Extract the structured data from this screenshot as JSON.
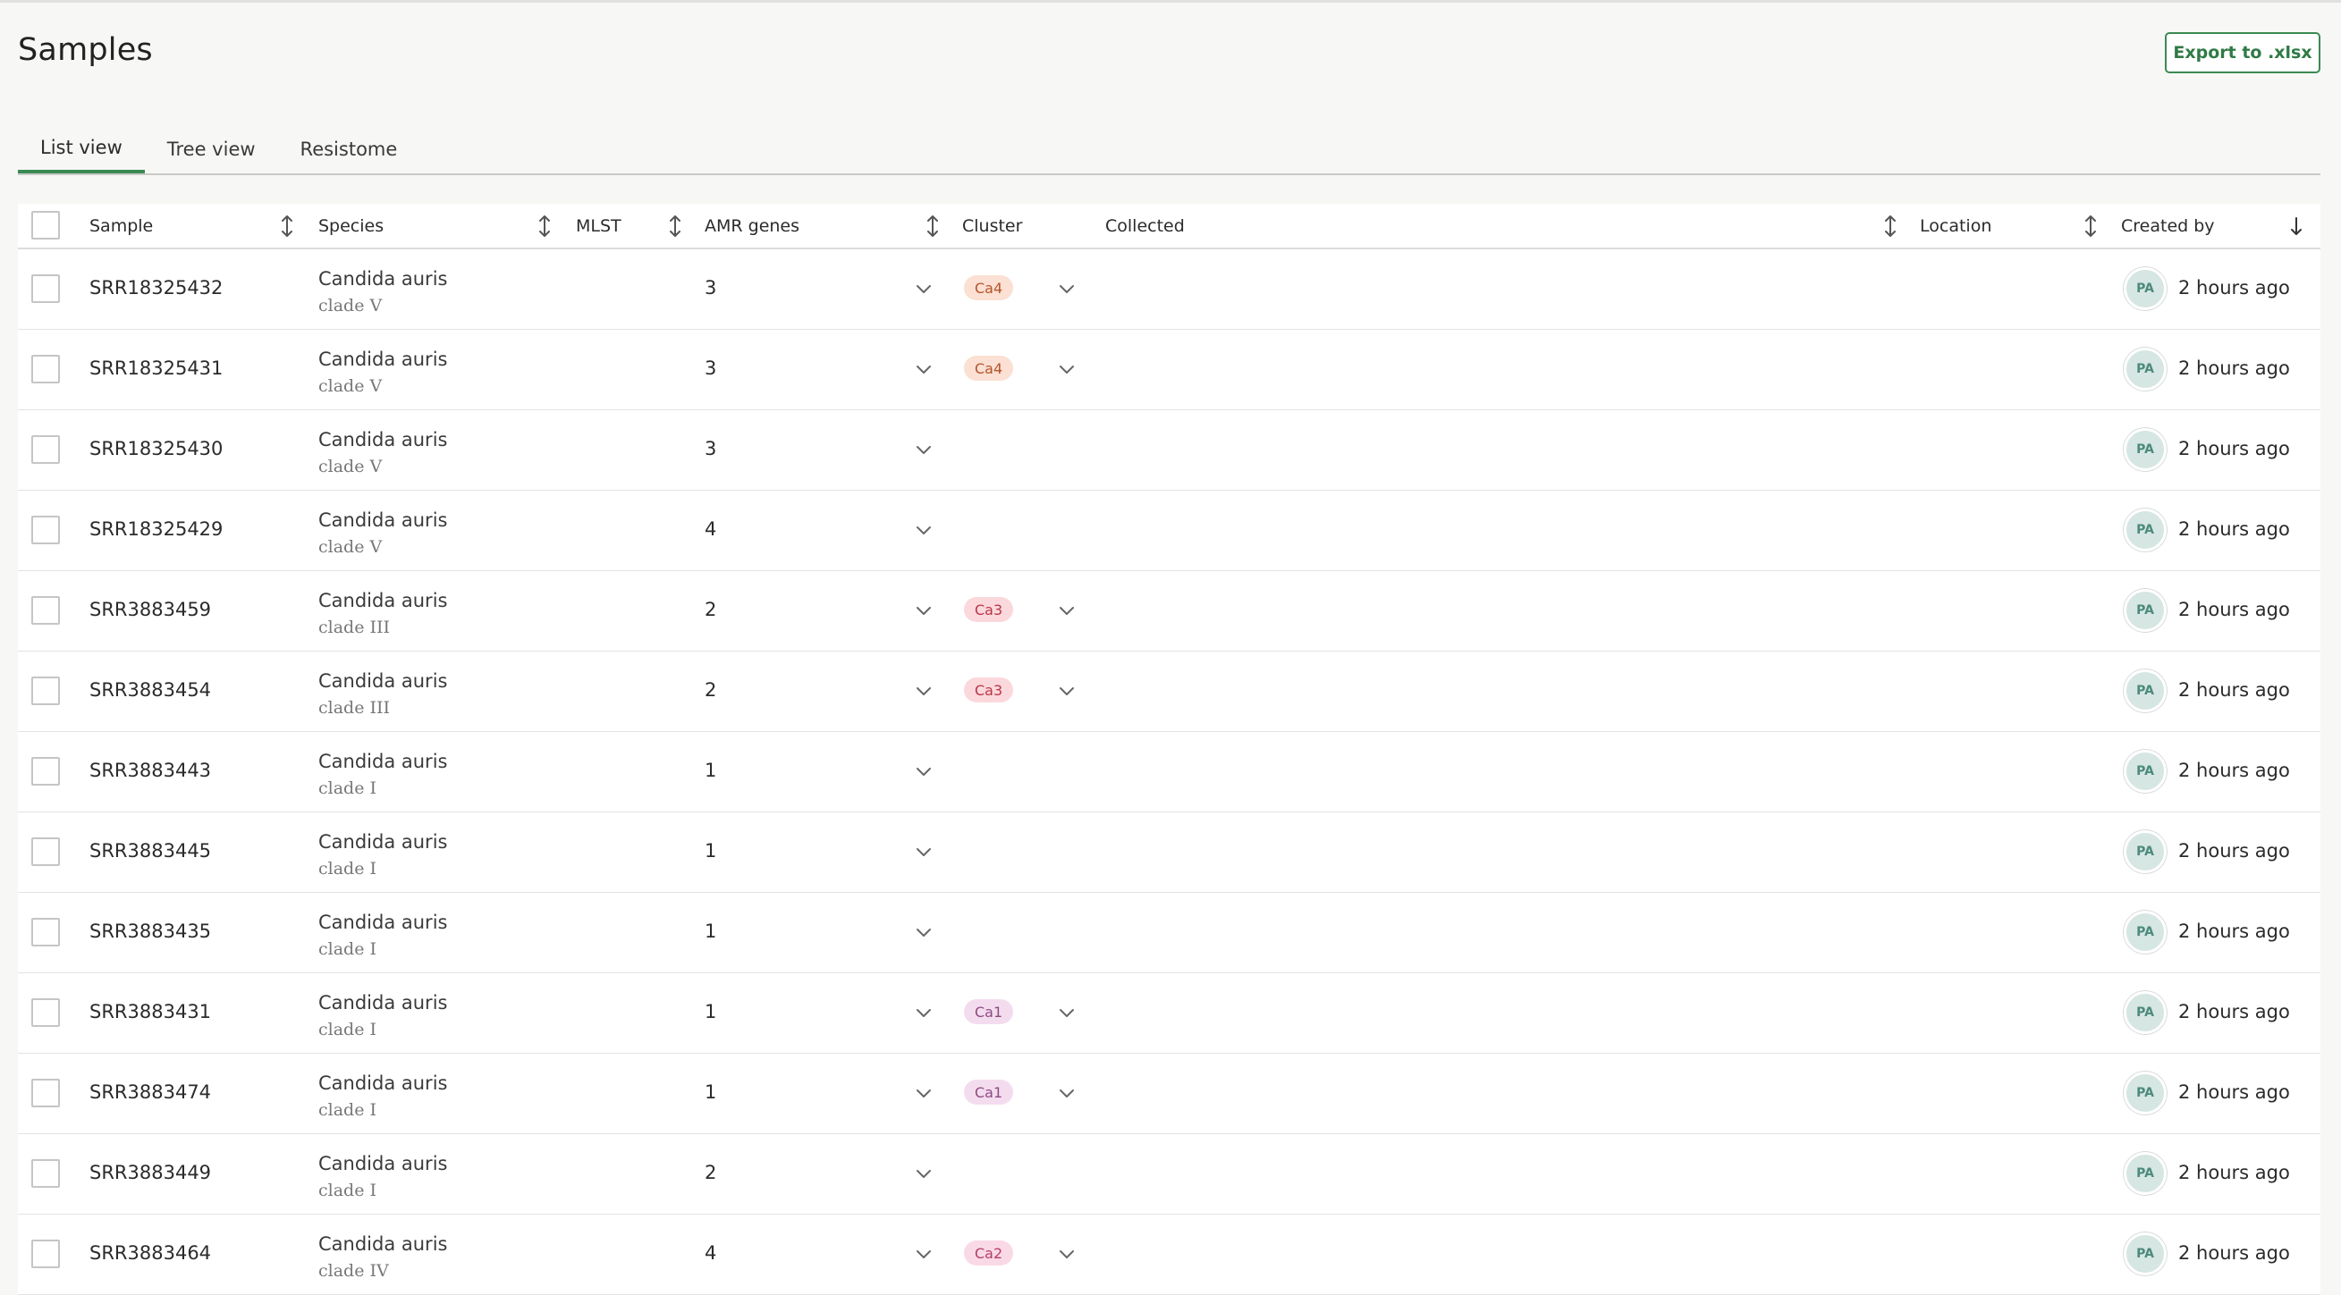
{
  "page": {
    "title": "Samples",
    "export_label": "Export to .xlsx"
  },
  "tabs": [
    {
      "label": "List view",
      "active": true
    },
    {
      "label": "Tree view",
      "active": false
    },
    {
      "label": "Resistome",
      "active": false
    }
  ],
  "columns": {
    "sample": "Sample",
    "species": "Species",
    "mlst": "MLST",
    "amr": "AMR genes",
    "cluster": "Cluster",
    "collected": "Collected",
    "location": "Location",
    "created_by": "Created by"
  },
  "colors": {
    "accent": "#3b8a52"
  },
  "cluster_styles": {
    "Ca4": {
      "bg": "#fbe0d3",
      "fg": "#b4552d"
    },
    "Ca3": {
      "bg": "#fbd8dc",
      "fg": "#b8384a"
    },
    "Ca1": {
      "bg": "#f4dcef",
      "fg": "#8d4b82"
    },
    "Ca2": {
      "bg": "#fad9e6",
      "fg": "#b43f6a"
    }
  },
  "rows": [
    {
      "sample": "SRR18325432",
      "species": "Candida auris",
      "clade": "clade V",
      "amr": "3",
      "cluster": "Ca4",
      "avatar": "PA",
      "created": "2 hours ago"
    },
    {
      "sample": "SRR18325431",
      "species": "Candida auris",
      "clade": "clade V",
      "amr": "3",
      "cluster": "Ca4",
      "avatar": "PA",
      "created": "2 hours ago"
    },
    {
      "sample": "SRR18325430",
      "species": "Candida auris",
      "clade": "clade V",
      "amr": "3",
      "cluster": "",
      "avatar": "PA",
      "created": "2 hours ago"
    },
    {
      "sample": "SRR18325429",
      "species": "Candida auris",
      "clade": "clade V",
      "amr": "4",
      "cluster": "",
      "avatar": "PA",
      "created": "2 hours ago"
    },
    {
      "sample": "SRR3883459",
      "species": "Candida auris",
      "clade": "clade III",
      "amr": "2",
      "cluster": "Ca3",
      "avatar": "PA",
      "created": "2 hours ago"
    },
    {
      "sample": "SRR3883454",
      "species": "Candida auris",
      "clade": "clade III",
      "amr": "2",
      "cluster": "Ca3",
      "avatar": "PA",
      "created": "2 hours ago"
    },
    {
      "sample": "SRR3883443",
      "species": "Candida auris",
      "clade": "clade I",
      "amr": "1",
      "cluster": "",
      "avatar": "PA",
      "created": "2 hours ago"
    },
    {
      "sample": "SRR3883445",
      "species": "Candida auris",
      "clade": "clade I",
      "amr": "1",
      "cluster": "",
      "avatar": "PA",
      "created": "2 hours ago"
    },
    {
      "sample": "SRR3883435",
      "species": "Candida auris",
      "clade": "clade I",
      "amr": "1",
      "cluster": "",
      "avatar": "PA",
      "created": "2 hours ago"
    },
    {
      "sample": "SRR3883431",
      "species": "Candida auris",
      "clade": "clade I",
      "amr": "1",
      "cluster": "Ca1",
      "avatar": "PA",
      "created": "2 hours ago"
    },
    {
      "sample": "SRR3883474",
      "species": "Candida auris",
      "clade": "clade I",
      "amr": "1",
      "cluster": "Ca1",
      "avatar": "PA",
      "created": "2 hours ago"
    },
    {
      "sample": "SRR3883449",
      "species": "Candida auris",
      "clade": "clade I",
      "amr": "2",
      "cluster": "",
      "avatar": "PA",
      "created": "2 hours ago"
    },
    {
      "sample": "SRR3883464",
      "species": "Candida auris",
      "clade": "clade IV",
      "amr": "4",
      "cluster": "Ca2",
      "avatar": "PA",
      "created": "2 hours ago"
    }
  ]
}
